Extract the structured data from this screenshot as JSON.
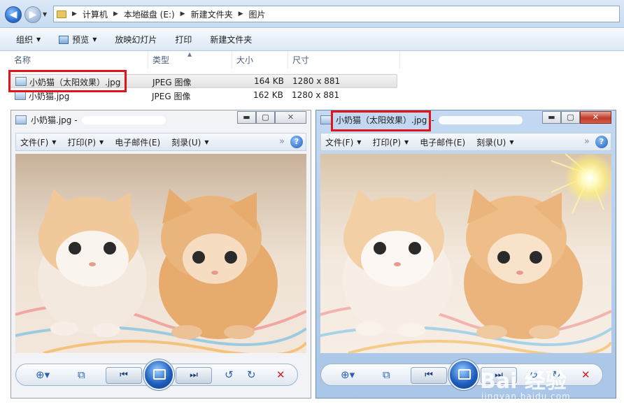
{
  "explorer": {
    "breadcrumb": [
      "计算机",
      "本地磁盘 (E:)",
      "新建文件夹",
      "图片"
    ],
    "toolbar": {
      "organize": "组织",
      "preview": "预览",
      "slideshow": "放映幻灯片",
      "print": "打印",
      "new_folder": "新建文件夹"
    },
    "columns": {
      "name": "名称",
      "type": "类型",
      "size": "大小",
      "dimensions": "尺寸"
    },
    "files": [
      {
        "name": "小奶猫（太阳效果）.jpg",
        "type": "JPEG 图像",
        "size": "164 KB",
        "dimensions": "1280 x 881"
      },
      {
        "name": "小奶猫.jpg",
        "type": "JPEG 图像",
        "size": "162 KB",
        "dimensions": "1280 x 881"
      }
    ]
  },
  "viewer_left": {
    "title": "小奶猫.jpg -",
    "menu": {
      "file": "文件(F)",
      "print": "打印(P)",
      "email": "电子邮件(E)",
      "burn": "刻录(U)"
    },
    "help": "?"
  },
  "viewer_right": {
    "title": "小奶猫（太阳效果）.jpg",
    "title_suffix": "-",
    "menu": {
      "file": "文件(F)",
      "print": "打印(P)",
      "email": "电子邮件(E)",
      "burn": "刻录(U)"
    },
    "help": "?"
  },
  "watermark": {
    "brand": "Bai 经验",
    "url": "jingyan.baidu.com"
  },
  "colors": {
    "highlight_red": "#e0151c",
    "accent_blue": "#2a62b2"
  },
  "icons": {
    "back": "arrow-left-icon",
    "forward": "arrow-right-icon",
    "zoom": "magnifier-icon",
    "fit": "fit-window-icon",
    "prev": "previous-icon",
    "next": "next-icon",
    "rotate_ccw": "rotate-left-icon",
    "rotate_cw": "rotate-right-icon",
    "delete": "delete-icon"
  }
}
